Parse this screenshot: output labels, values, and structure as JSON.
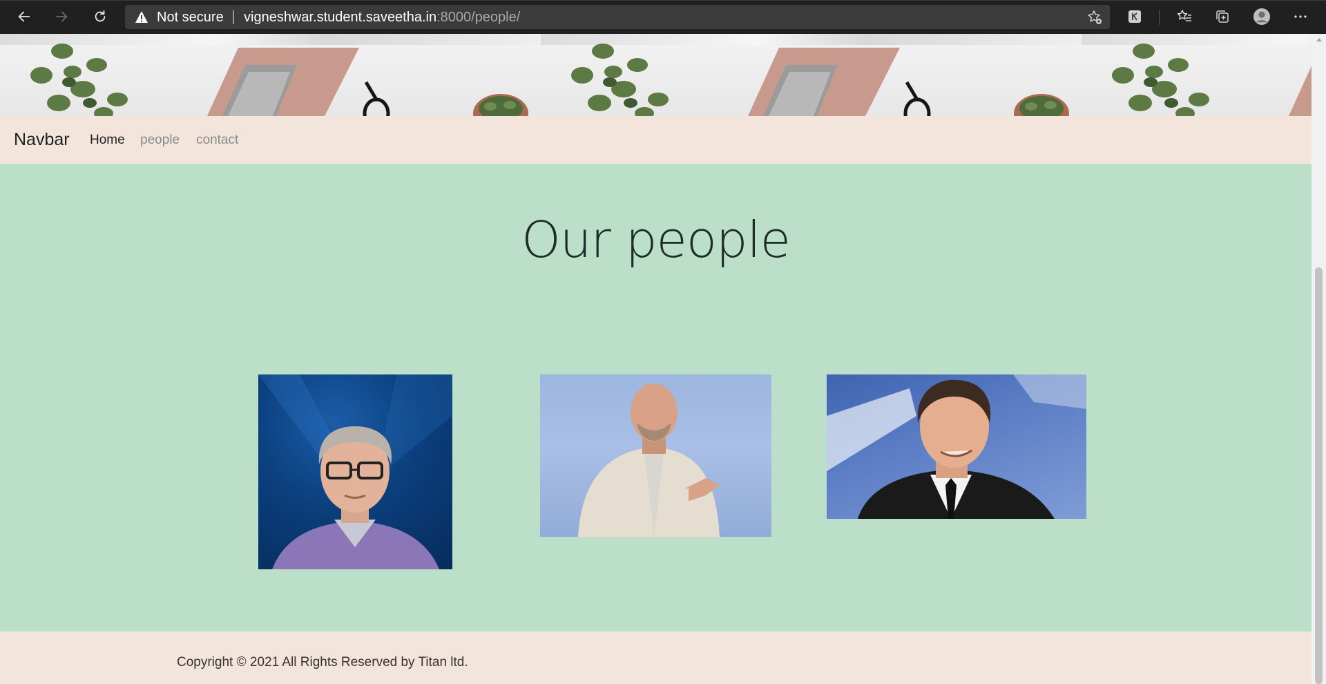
{
  "browser": {
    "security_label": "Not secure",
    "url_host": "vigneshwar.student.saveetha.in",
    "url_path": ":8000/people/",
    "icons": [
      "back-arrow-icon",
      "forward-arrow-icon",
      "reload-icon",
      "warning-icon",
      "add-favorite-icon",
      "extension-icon",
      "favorites-icon",
      "collections-icon",
      "profile-icon",
      "more-icon"
    ]
  },
  "banner": {
    "description_icon": "desk-banner-image"
  },
  "navbar": {
    "brand": "Navbar",
    "links": [
      {
        "label": "Home"
      },
      {
        "label": "people"
      },
      {
        "label": "contact"
      }
    ]
  },
  "main": {
    "title": "Our people",
    "people": [
      {
        "image": "person-photo-1"
      },
      {
        "image": "person-photo-2"
      },
      {
        "image": "person-photo-3"
      }
    ]
  },
  "footer": {
    "copyright": "Copyright © 2021 All Rights Reserved by Titan ltd."
  },
  "colors": {
    "page_bg": "#bbdfc8",
    "navbar_bg": "#f3e5db",
    "chrome_bg": "#202020"
  }
}
